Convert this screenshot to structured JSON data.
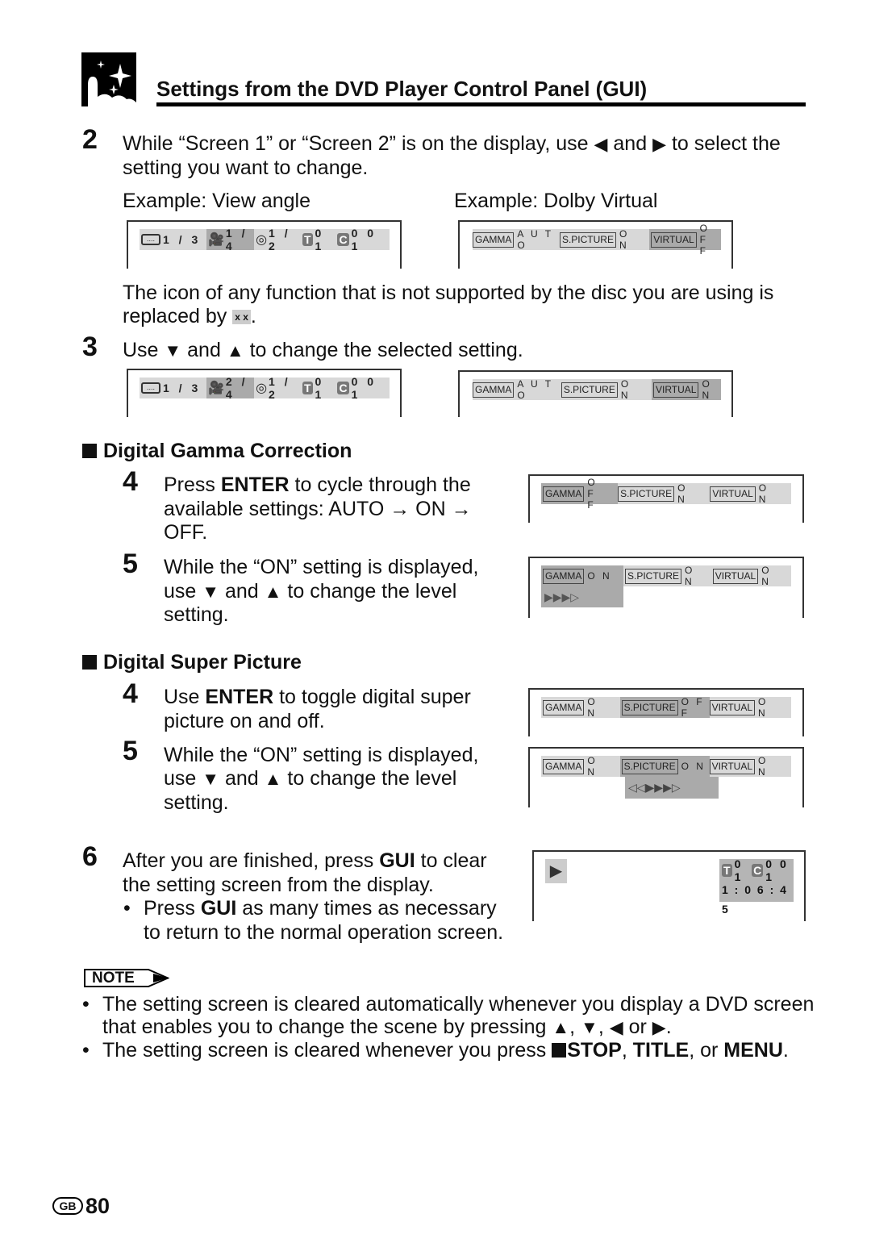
{
  "header": {
    "title": "Settings from the DVD Player Control Panel (GUI)"
  },
  "step2": {
    "number": "2",
    "line1a": "While “Screen 1” or “Screen 2” is on the display, use",
    "and": "and",
    "line1b": "to select the",
    "line2": "setting you want to change.",
    "example1": "Example: View angle",
    "example2": "Example: Dolby Virtual"
  },
  "unsupported": {
    "line1": "The icon of any function that is not supported by the disc you are using is",
    "line2": "replaced by",
    "xx": "x x",
    "period": "."
  },
  "step3": {
    "number": "3",
    "a": "Use",
    "and": "and",
    "b": "to change the selected setting."
  },
  "osd": {
    "view1": {
      "subtitle": "1 / 3",
      "angle": "1 / 4",
      "audio": "1 / 2",
      "t": "T",
      "title": "0 1",
      "c": "C",
      "chapter": "0 0 1"
    },
    "view2": {
      "subtitle": "1 / 3",
      "angle": "2 / 4",
      "audio": "1 / 2",
      "t": "T",
      "title": "0 1",
      "c": "C",
      "chapter": "0 0 1"
    },
    "gamma": "GAMMA",
    "spicture": "S.PICTURE",
    "virtual": "VIRTUAL",
    "dolby1": {
      "gamma": "A U T O",
      "spicture": "O N",
      "virtual": "O F F"
    },
    "dolby2": {
      "gamma": "A U T O",
      "spicture": "O N",
      "virtual": "O N"
    },
    "g1": {
      "gamma": "O F F",
      "spicture": "O N",
      "virtual": "O N"
    },
    "g2": {
      "gamma": "O N",
      "spicture": "O N",
      "virtual": "O N",
      "level": "▶▶▶▷"
    },
    "s1": {
      "gamma": "O N",
      "spicture": "O F F",
      "virtual": "O N"
    },
    "s2": {
      "gamma": "O N",
      "spicture": "O N",
      "virtual": "O N",
      "level": "◁◁▶▶▶▷"
    },
    "normal": {
      "t": "T",
      "title": "0 1",
      "c": "C",
      "chapter": "0 0 1",
      "time": "1 : 0 6 : 4 5"
    }
  },
  "gamma_section": {
    "heading": "Digital Gamma Correction",
    "step4": {
      "number": "4",
      "l1a": "Press",
      "l1b": "ENTER",
      "l1c": "to cycle through the",
      "l2": "available settings: AUTO → ON →",
      "l3": "OFF."
    },
    "step5": {
      "number": "5",
      "l1": "While the “ON” setting is displayed,",
      "l2a": "use",
      "and": "and",
      "l2b": "to change the level",
      "l3": "setting."
    }
  },
  "spicture_section": {
    "heading": "Digital Super Picture",
    "step4": {
      "number": "4",
      "l1a": "Use",
      "l1b": "ENTER",
      "l1c": "to toggle digital super",
      "l2": "picture on and off."
    },
    "step5": {
      "number": "5",
      "l1": "While the “ON” setting is displayed,",
      "l2a": "use",
      "and": "and",
      "l2b": "to change the level",
      "l3": "setting."
    }
  },
  "step6": {
    "number": "6",
    "l1a": "After you are finished, press",
    "l1b": "GUI",
    "l1c": "to clear",
    "l2": "the setting screen from the display.",
    "b1a": "Press",
    "b1b": "GUI",
    "b1c": "as many times as necessary",
    "b2": "to return to the normal operation screen."
  },
  "note": {
    "label": "NOTE",
    "n1l1": "The setting screen is cleared automatically whenever you display a DVD screen",
    "n1l2": "that enables you to change the scene by pressing",
    "n1sep": ",",
    "n1or": "or",
    "n1end": ".",
    "n2a": "The setting screen is cleared whenever you press",
    "n2stop": "STOP",
    "n2c": ",",
    "n2title": "TITLE",
    "n2or": ", or",
    "n2menu": "MENU",
    "n2end": "."
  },
  "footer": {
    "region": "GB",
    "page": "80"
  }
}
